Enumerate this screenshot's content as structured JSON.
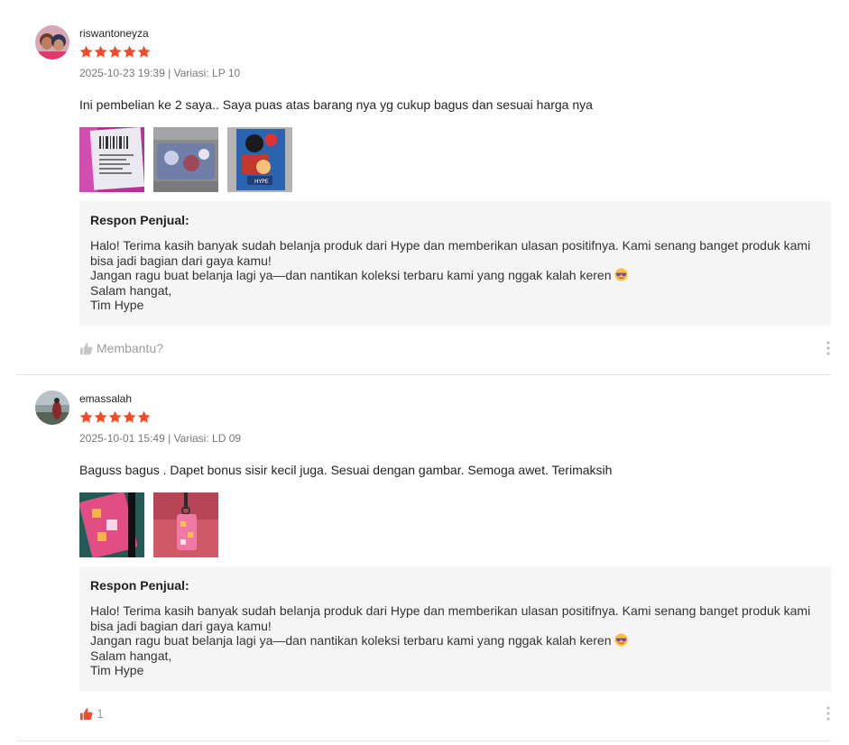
{
  "colors": {
    "accent": "#ee4d2d",
    "response_bg": "#f5f5f5",
    "divider": "#e5e5e5"
  },
  "reviews": [
    {
      "username": "riswantoneyza",
      "rating": 5,
      "date": "2025-10-23 19:39",
      "separator": "|",
      "variation": "Variasi: LP 10",
      "comment": "Ini pembelian ke 2 saya.. Saya puas atas barang nya yg cukup bagus dan sesuai harga nya",
      "photos": [
        "photo-package-label",
        "photo-product-blue",
        "photo-product-anime"
      ],
      "response": {
        "title": "Respon Penjual:",
        "lines": [
          "Halo! Terima kasih banyak sudah belanja produk dari Hype dan memberikan ulasan positifnya. Kami senang banget produk kami",
          "bisa jadi bagian dari gaya kamu!",
          "Jangan ragu buat belanja lagi ya—dan nantikan koleksi terbaru kami yang nggak kalah keren",
          "Salam hangat,",
          "Tim Hype"
        ],
        "emoji": "sunglasses-emoji"
      },
      "helpful_label": "Membantu?",
      "helpful_icon": "thumbs-up-icon"
    },
    {
      "username": "emassalah",
      "rating": 5,
      "date": "2025-10-01 15:49",
      "separator": "|",
      "variation": "Variasi: LD 09",
      "comment": "Baguss bagus . Dapet bonus sisir kecil juga. Sesuai dengan gambar. Semoga awet. Terimaksih",
      "photos": [
        "photo-pink-case",
        "photo-keychain"
      ],
      "response": {
        "title": "Respon Penjual:",
        "lines": [
          "Halo! Terima kasih banyak sudah belanja produk dari Hype dan memberikan ulasan positifnya. Kami senang banget produk kami",
          "bisa jadi bagian dari gaya kamu!",
          "Jangan ragu buat belanja lagi ya—dan nantikan koleksi terbaru kami yang nggak kalah keren",
          "Salam hangat,",
          "Tim Hype"
        ],
        "emoji": "sunglasses-emoji"
      },
      "helpful_label": "1",
      "helpful_icon": "thumbs-up-icon"
    }
  ]
}
